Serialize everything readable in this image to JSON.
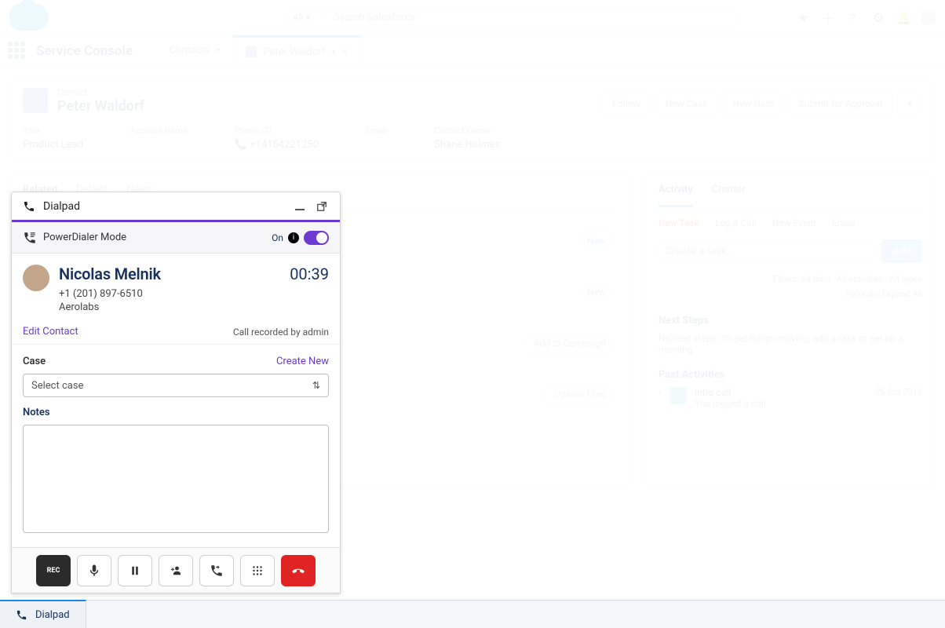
{
  "header": {
    "search_selector": "All",
    "search_placeholder": "Search Salesforce"
  },
  "console": {
    "title": "Service Console",
    "nav_dropdown": "Contacts",
    "workspace_tab": "Peter Waldorf"
  },
  "record": {
    "object_label": "Contact",
    "name": "Peter Waldorf",
    "actions": {
      "follow": "Follow",
      "new_case": "New Case",
      "new_note": "New Note",
      "submit": "Submit for Approval"
    },
    "fields": {
      "title_label": "Title",
      "title": "Product Lead",
      "account_label": "Account Name",
      "account": "",
      "phone_label": "Phone (2)",
      "phone": "+14154221250",
      "email_label": "Email",
      "email": "",
      "owner_label": "Contact Owner",
      "owner": "Shane Holmes"
    },
    "tabs": {
      "related": "Related",
      "details": "Details",
      "news": "News"
    },
    "related_actions": {
      "new": "New",
      "new2": "New",
      "add_campaign": "Add to Campaign",
      "upload": "Upload Files"
    }
  },
  "activity": {
    "tab_activity": "Activity",
    "tab_chatter": "Chatter",
    "composer": {
      "new_task": "New Task",
      "log_call": "Log a Call",
      "new_event": "New Event",
      "email": "Email"
    },
    "task_placeholder": "Create a task...",
    "add": "Add",
    "filter": "Filters: All time · All activities · All types",
    "refresh": "Refresh · Expand All",
    "next_steps_h": "Next Steps",
    "next_steps_body": "No next steps. To get things moving, add a task or set up a meeting.",
    "past_h": "Past Activities",
    "past_item_title": "Intro call",
    "past_item_sub": "You logged a call",
    "past_item_date": "26 Oct 2018"
  },
  "dialpad": {
    "panel_title": "Dialpad",
    "powerdialer_label": "PowerDialer Mode",
    "powerdialer_state": "On",
    "callee_name": "Nicolas Melnik",
    "callee_phone": "+1 (201) 897-6510",
    "callee_company": "Aerolabs",
    "timer": "00:39",
    "edit_contact": "Edit Contact",
    "recorded_by": "Call recorded by admin",
    "case_label": "Case",
    "create_new": "Create New",
    "case_placeholder": "Select case",
    "notes_label": "Notes",
    "utility_label": "Dialpad"
  }
}
